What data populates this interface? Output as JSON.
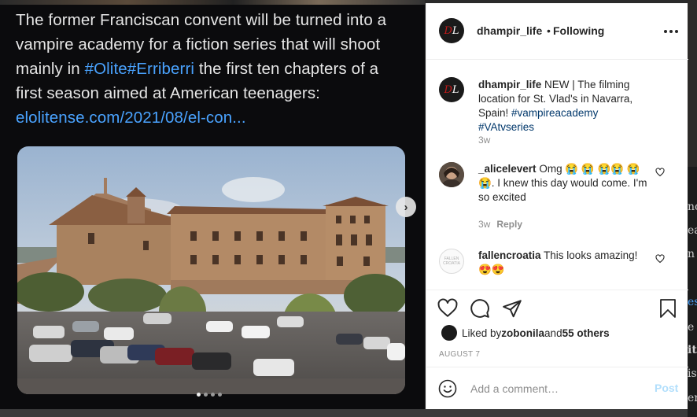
{
  "caption": {
    "line1": "The former Franciscan convent will be turned into a",
    "line2": "vampire academy for a fiction series that will shoot",
    "line3_a": "mainly in ",
    "line3_tags": "#Olite#Erriberri",
    "line3_b": " the first ten chapters of a",
    "line4": "first season aimed at American teenagers:",
    "link": "elolitense.com/2021/08/el-con..."
  },
  "carousel": {
    "next_glyph": "›",
    "dot_count": 4,
    "active_dot": 0
  },
  "header": {
    "username": "dhampir_life",
    "separator": "•",
    "follow_state": "Following",
    "avatar_letters": {
      "first": "D",
      "second": "L"
    }
  },
  "comments": [
    {
      "username": "dhampir_life",
      "text": "NEW | The filming location for St. Vlad's in Navarra, Spain! ",
      "tags": "#vampireacademy #VAtvseries",
      "age": "3w"
    },
    {
      "username": "_alicelevert",
      "text": "Omg 😭 😭 😭😭 😭😭. I knew this day would come. I'm so excited",
      "age": "3w",
      "reply_label": "Reply"
    },
    {
      "username": "fallencroatia",
      "text": "This looks amazing! 😍😍",
      "avatar_text": "FALLEN CROATIA"
    }
  ],
  "likes": {
    "prefix": "Liked by ",
    "user": "zobonila",
    "mid": " and ",
    "others": "55 others"
  },
  "date": "AUGUST 7",
  "comment_box": {
    "placeholder": "Add a comment…",
    "post_label": "Post"
  },
  "colors": {
    "link_blue": "#4aa3ff",
    "tag_blue": "#00376b",
    "post_disabled": "#b2dffc",
    "muted": "#8e8e8e"
  },
  "background_fragments": [
    "nc",
    "ea",
    "n",
    "es",
    "e",
    "it",
    "is",
    "er"
  ]
}
